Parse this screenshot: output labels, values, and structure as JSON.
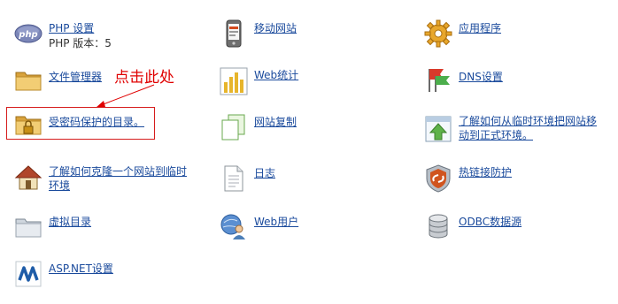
{
  "colors": {
    "link": "#1a4a9c",
    "annotation": "#e00000"
  },
  "annotation": {
    "text": "点击此处"
  },
  "col1": {
    "php": {
      "label": "PHP 设置",
      "sub": "PHP 版本：5",
      "icon": "php-icon"
    },
    "file_manager": {
      "label": "文件管理器",
      "icon": "folder-icon"
    },
    "password_dirs": {
      "label": "受密码保护的目录。",
      "icon": "locked-folder-icon"
    },
    "clone_site": {
      "line1": "了解如何克隆一个网站到临时",
      "line2": "环境",
      "icon": "house-icon"
    },
    "virtual_dir": {
      "label": "虚拟目录",
      "icon": "folder-icon"
    },
    "aspnet": {
      "label": "ASP.NET设置",
      "icon": "dotnet-icon"
    }
  },
  "col2": {
    "mobile": {
      "label": "移动网站",
      "icon": "mobile-phone-icon"
    },
    "webstats": {
      "label": "Web统计",
      "icon": "bar-chart-icon"
    },
    "site_copy": {
      "label": "网站复制",
      "icon": "copy-icon"
    },
    "logs": {
      "label": "日志",
      "icon": "document-icon"
    },
    "web_users": {
      "label": "Web用户",
      "icon": "web-user-icon"
    }
  },
  "col3": {
    "apps": {
      "label": "应用程序",
      "icon": "gear-icon"
    },
    "dns": {
      "label": "DNS设置",
      "icon": "flags-icon"
    },
    "staging": {
      "line1": "了解如何从临时环境把网站移",
      "line2": "动到正式环境。",
      "icon": "upload-icon"
    },
    "hotlink": {
      "label": "热链接防护",
      "icon": "shield-icon"
    },
    "odbc": {
      "label": "ODBC数据源",
      "icon": "database-icon"
    }
  }
}
